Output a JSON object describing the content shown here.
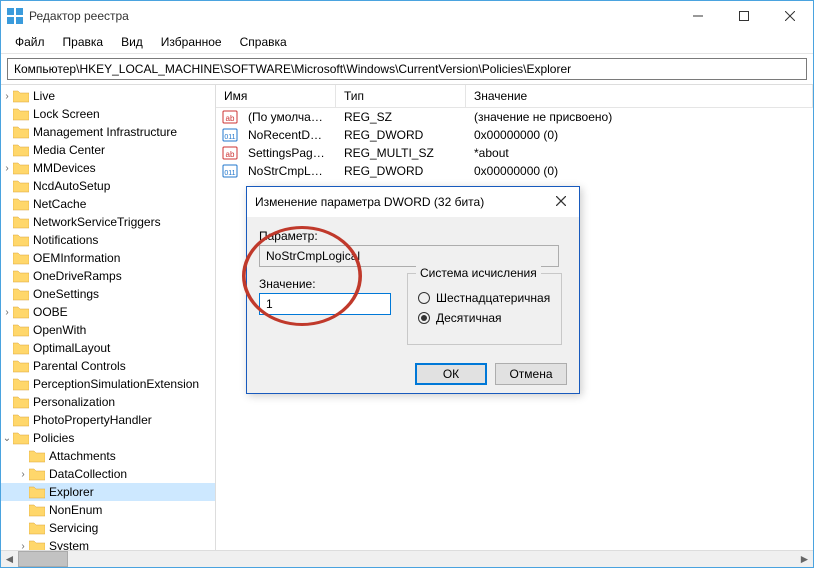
{
  "window": {
    "title": "Редактор реестра"
  },
  "menu": {
    "file": "Файл",
    "edit": "Правка",
    "view": "Вид",
    "favorites": "Избранное",
    "help": "Справка"
  },
  "path": "Компьютер\\HKEY_LOCAL_MACHINE\\SOFTWARE\\Microsoft\\Windows\\CurrentVersion\\Policies\\Explorer",
  "tree": [
    {
      "d": 0,
      "exp": ">",
      "l": "Live"
    },
    {
      "d": 0,
      "exp": "",
      "l": "Lock Screen"
    },
    {
      "d": 0,
      "exp": "",
      "l": "Management Infrastructure"
    },
    {
      "d": 0,
      "exp": "",
      "l": "Media Center"
    },
    {
      "d": 0,
      "exp": ">",
      "l": "MMDevices"
    },
    {
      "d": 0,
      "exp": "",
      "l": "NcdAutoSetup"
    },
    {
      "d": 0,
      "exp": "",
      "l": "NetCache"
    },
    {
      "d": 0,
      "exp": "",
      "l": "NetworkServiceTriggers"
    },
    {
      "d": 0,
      "exp": "",
      "l": "Notifications"
    },
    {
      "d": 0,
      "exp": "",
      "l": "OEMInformation"
    },
    {
      "d": 0,
      "exp": "",
      "l": "OneDriveRamps"
    },
    {
      "d": 0,
      "exp": "",
      "l": "OneSettings"
    },
    {
      "d": 0,
      "exp": ">",
      "l": "OOBE"
    },
    {
      "d": 0,
      "exp": "",
      "l": "OpenWith"
    },
    {
      "d": 0,
      "exp": "",
      "l": "OptimalLayout"
    },
    {
      "d": 0,
      "exp": "",
      "l": "Parental Controls"
    },
    {
      "d": 0,
      "exp": "",
      "l": "PerceptionSimulationExtension"
    },
    {
      "d": 0,
      "exp": "",
      "l": "Personalization"
    },
    {
      "d": 0,
      "exp": "",
      "l": "PhotoPropertyHandler"
    },
    {
      "d": 0,
      "exp": "v",
      "l": "Policies"
    },
    {
      "d": 1,
      "exp": "",
      "l": "Attachments"
    },
    {
      "d": 1,
      "exp": ">",
      "l": "DataCollection"
    },
    {
      "d": 1,
      "exp": "",
      "l": "Explorer",
      "sel": true
    },
    {
      "d": 1,
      "exp": "",
      "l": "NonEnum"
    },
    {
      "d": 1,
      "exp": "",
      "l": "Servicing"
    },
    {
      "d": 1,
      "exp": ">",
      "l": "System"
    }
  ],
  "list_headers": {
    "name": "Имя",
    "type": "Тип",
    "value": "Значение"
  },
  "list": [
    {
      "icon": "sz",
      "name": "(По умолчанию)",
      "type": "REG_SZ",
      "value": "(значение не присвоено)"
    },
    {
      "icon": "bin",
      "name": "NoRecentDocsH...",
      "type": "REG_DWORD",
      "value": "0x00000000 (0)"
    },
    {
      "icon": "sz",
      "name": "SettingsPageVisi...",
      "type": "REG_MULTI_SZ",
      "value": "*about"
    },
    {
      "icon": "bin",
      "name": "NoStrCmpLogical",
      "type": "REG_DWORD",
      "value": "0x00000000 (0)"
    }
  ],
  "dialog": {
    "title": "Изменение параметра DWORD (32 бита)",
    "param_label": "Параметр:",
    "param_value": "NoStrCmpLogical",
    "value_label": "Значение:",
    "value_value": "1",
    "base_caption": "Система исчисления",
    "radio_hex": "Шестнадцатеричная",
    "radio_dec": "Десятичная",
    "ok": "ОК",
    "cancel": "Отмена"
  }
}
